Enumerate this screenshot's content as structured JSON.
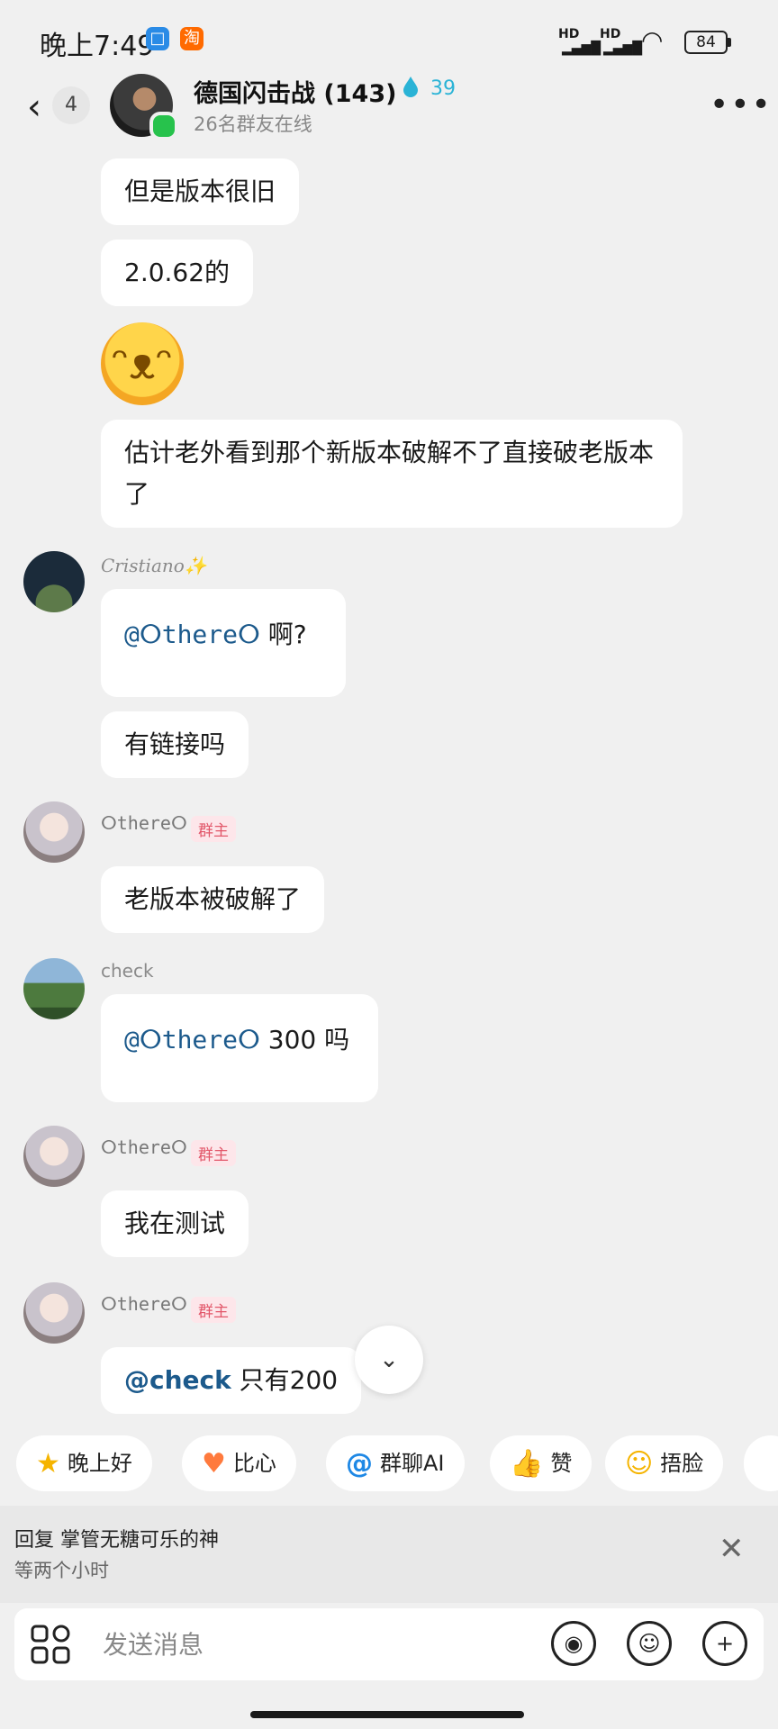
{
  "status_bar": {
    "time": "晚上7:49",
    "app_icons": [
      "□",
      "淘"
    ],
    "signal_1": "HD",
    "signal_2": "HD",
    "battery": "84"
  },
  "header": {
    "back_badge": "4",
    "title": "德国闪击战 (143)",
    "drop_count": "39",
    "subtitle": "26名群友在线"
  },
  "messages": {
    "m1": "但是版本很旧",
    "m2": "2.0.62的",
    "m3": "估计老外看到那个新版本破解不了直接破老版本了",
    "cristiano_name": "Cristiano✨",
    "m4_mention": "@ⵔthereⵔ",
    "m4_text": " 啊?",
    "m5": "有链接吗",
    "there_name": "ⵔthereⵔ",
    "owner_badge": "群主",
    "m6": "老版本被破解了",
    "check_name": "check",
    "m7_mention": "@ⵔthereⵔ",
    "m7_text": " 300 吗",
    "m8": "我在测试",
    "m9_mention": "@check",
    "m9_text": " 只有200"
  },
  "chips": [
    {
      "icon": "★",
      "label": "晚上好"
    },
    {
      "icon": "♥",
      "label": "比心"
    },
    {
      "icon": "@",
      "label": "群聊AI"
    },
    {
      "icon": "👍",
      "label": "赞"
    },
    {
      "icon": "☺",
      "label": "捂脸"
    }
  ],
  "reply": {
    "title": "回复 掌管无糖可乐的神",
    "quote": "等两个小时"
  },
  "input": {
    "placeholder": "发送消息"
  },
  "colors": {
    "accent_mention": "#1c5a8c",
    "online": "#27c24c",
    "owner_badge_bg": "#fde6ea",
    "owner_badge_fg": "#e2576a"
  }
}
